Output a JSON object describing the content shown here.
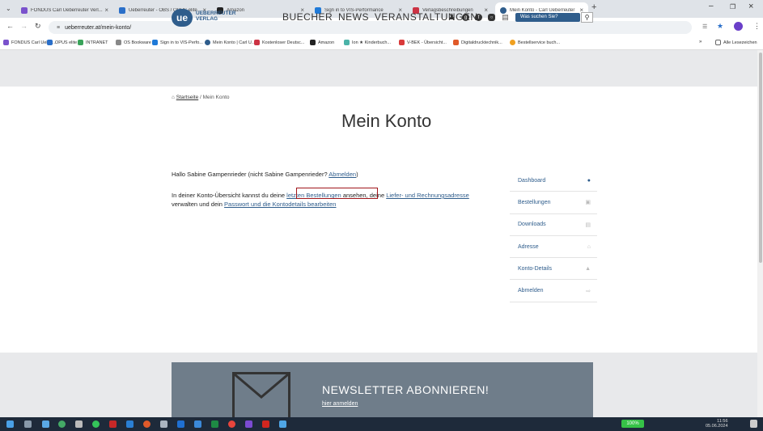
{
  "browser": {
    "tabs": [
      {
        "label": "FONDUS Carl Ueberreuter Verl...",
        "color": "#7a52cc"
      },
      {
        "label": "Ueberreuter - OBS / OPUS elite...",
        "color": "#2a6fc9"
      },
      {
        "label": "Amazon",
        "color": "#222222"
      },
      {
        "label": "Sign in to VIS-Performance",
        "color": "#1f7ad8"
      },
      {
        "label": "Verlagsbeschreibungen",
        "color": "#cc3344"
      },
      {
        "label": "Mein Konto - Carl Ueberreuter",
        "color": "#2f5d8c"
      }
    ],
    "address": "ueberreuter.at/mein-konto/",
    "bookmarks": [
      "FONDUS Carl Ueber...",
      "OPUS elite",
      "INTRANET",
      "OS Bookware",
      "Sign in to VIS-Perfo...",
      "Mein Konto | Carl U...",
      "Kostenloser Deutsc...",
      "Amazon",
      "Ion ★ Kinderbuch...",
      "V-BEK - Übersicht...",
      "Digitaldrucktechnik...",
      "Bestellservice buch...",
      "Alle Lesezeichen"
    ]
  },
  "header": {
    "logo_mark": "ue",
    "logo_line1": "UEBERREUTER",
    "logo_line2": "VERLAG",
    "nav": "BUECHER NEWS VERANSTALTUNGEN",
    "search_placeholder": "Was suchen Sie?"
  },
  "breadcrumb": {
    "home": "Startseite",
    "separator": " / ",
    "current": "Mein Konto"
  },
  "page": {
    "title": "Mein Konto",
    "greeting_pre": "Hallo Sabine Gampenrieder (nicht Sabine Gampenrieder? ",
    "greeting_link": "Abmelden",
    "greeting_post": ")",
    "overview_1": "In deiner Konto-Übersicht kannst du deine ",
    "overview_link1": "letzten Bestellungen",
    "overview_2": " ansehen, deine ",
    "overview_link2": "Liefer- und Rechnungsadresse",
    "overview_3": " verwalten und dein ",
    "overview_link3": "Passwort und die Kontodetails bearbeiten",
    "overview_4": "."
  },
  "account_nav": [
    {
      "label": "Dashboard",
      "icon": "●"
    },
    {
      "label": "Bestellungen",
      "icon": "▣"
    },
    {
      "label": "Downloads",
      "icon": "▤"
    },
    {
      "label": "Adresse",
      "icon": "⌂"
    },
    {
      "label": "Konto-Details",
      "icon": "▲"
    },
    {
      "label": "Abmelden",
      "icon": "⇨"
    }
  ],
  "newsletter": {
    "title": "NEWSLETTER ABONNIEREN!",
    "link": "hier anmelden"
  },
  "taskbar": {
    "battery": "100%",
    "time": "11:56",
    "date": "05.06.2024"
  }
}
